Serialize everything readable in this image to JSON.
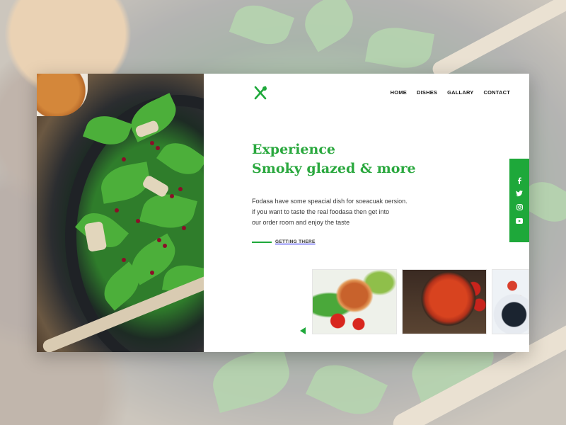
{
  "brand": {
    "logo_icon": "fork-knife-icon",
    "accent": "#1ea83a"
  },
  "nav": {
    "items": [
      {
        "label": "HOME"
      },
      {
        "label": "DISHES"
      },
      {
        "label": "GALLARY"
      },
      {
        "label": "CONTACT"
      }
    ]
  },
  "hero": {
    "title_line1": "Experience",
    "title_line2": "Smoky glazed & more",
    "desc_line1": "Fodasa have some speacial dish for soeacuak oersion.",
    "desc_line2": "if you want to taste the real foodasa then get into",
    "desc_line3": "our order room and enjoy the taste",
    "cta_label": "GETTING THERE"
  },
  "social": [
    {
      "icon": "facebook-icon"
    },
    {
      "icon": "twitter-icon"
    },
    {
      "icon": "instagram-icon"
    },
    {
      "icon": "youtube-icon"
    }
  ],
  "gallery": {
    "prev_icon": "arrow-left-icon",
    "thumbnails": [
      {
        "subject": "grilled-salmon"
      },
      {
        "subject": "shakshuka-pan"
      },
      {
        "subject": "seafood-plate"
      }
    ]
  }
}
